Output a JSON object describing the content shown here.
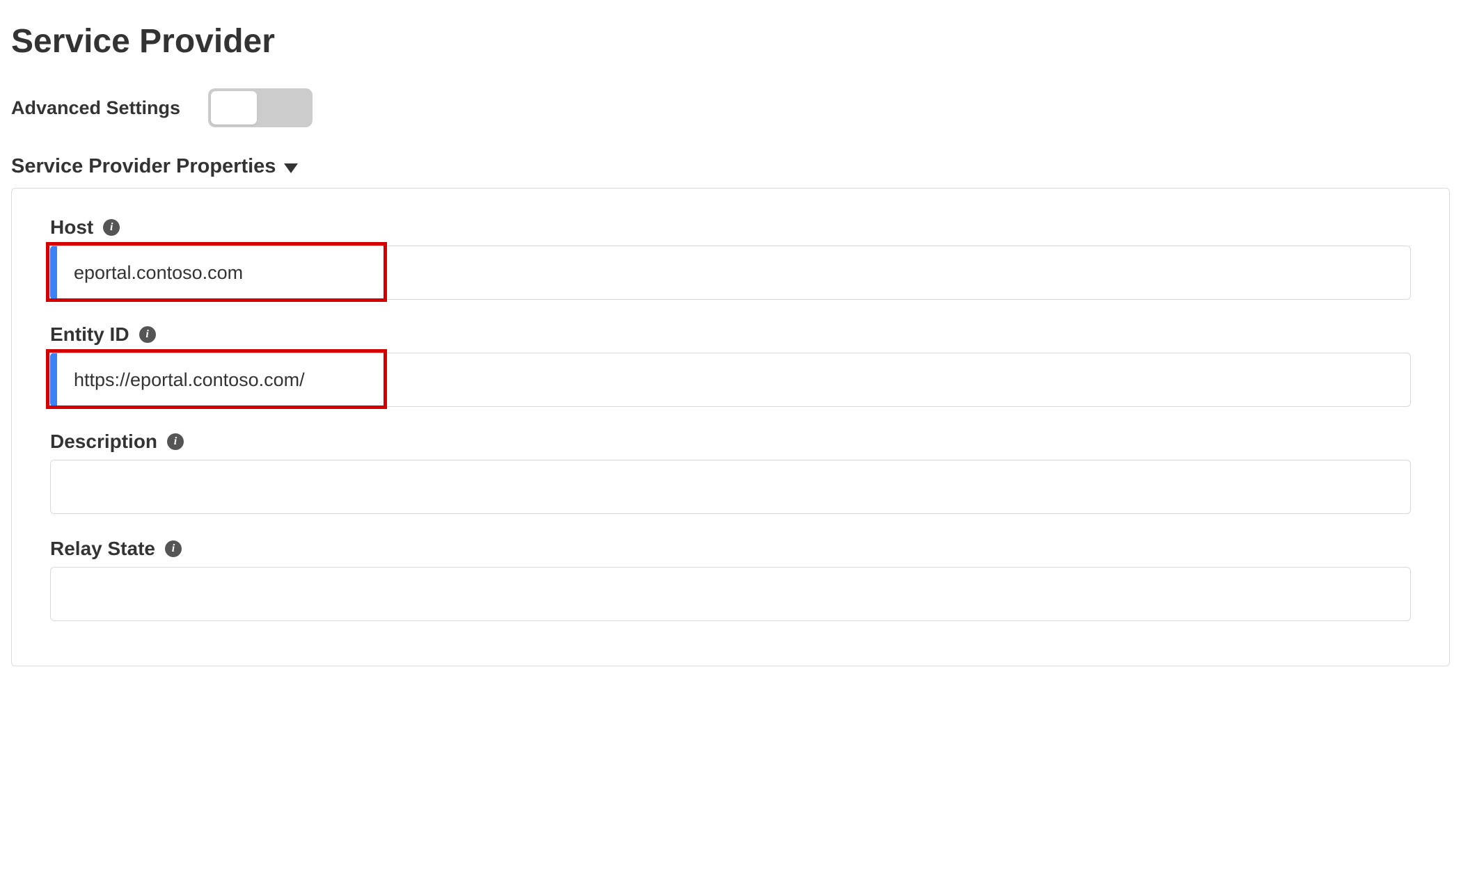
{
  "page": {
    "title": "Service Provider"
  },
  "advanced": {
    "label": "Advanced Settings"
  },
  "section": {
    "title": "Service Provider Properties"
  },
  "fields": {
    "host": {
      "label": "Host",
      "value": "eportal.contoso.com"
    },
    "entity_id": {
      "label": "Entity ID",
      "value": "https://eportal.contoso.com/"
    },
    "description": {
      "label": "Description",
      "value": ""
    },
    "relay_state": {
      "label": "Relay State",
      "value": ""
    }
  }
}
